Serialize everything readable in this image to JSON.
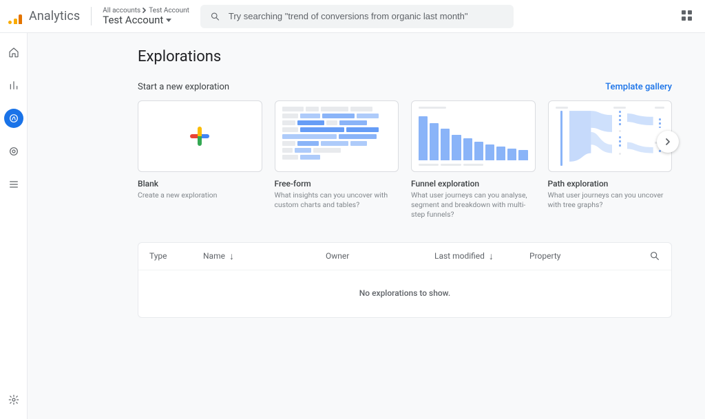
{
  "header": {
    "product_name": "Analytics",
    "breadcrumb_parent": "All accounts",
    "breadcrumb_child": "Test Account",
    "account_selected": "Test Account",
    "search_placeholder": "Try searching \"trend of conversions from organic last month\""
  },
  "sidebar": {
    "items": [
      {
        "name": "home",
        "active": false
      },
      {
        "name": "reports",
        "active": false
      },
      {
        "name": "explore",
        "active": true
      },
      {
        "name": "advertising",
        "active": false
      },
      {
        "name": "configure",
        "active": false
      }
    ],
    "settings": "settings"
  },
  "page": {
    "title": "Explorations",
    "subtitle": "Start a new exploration",
    "gallery_link": "Template gallery"
  },
  "templates": [
    {
      "title": "Blank",
      "desc": "Create a new exploration"
    },
    {
      "title": "Free-form",
      "desc": "What insights can you uncover with custom charts and tables?"
    },
    {
      "title": "Funnel exploration",
      "desc": "What user journeys can you analyse, segment and breakdown with multi-step funnels?"
    },
    {
      "title": "Path exploration",
      "desc": "What user journeys can you uncover with tree graphs?"
    }
  ],
  "table": {
    "columns": {
      "type": "Type",
      "name": "Name",
      "owner": "Owner",
      "last_modified": "Last modified",
      "property": "Property"
    },
    "empty_message": "No explorations to show."
  }
}
